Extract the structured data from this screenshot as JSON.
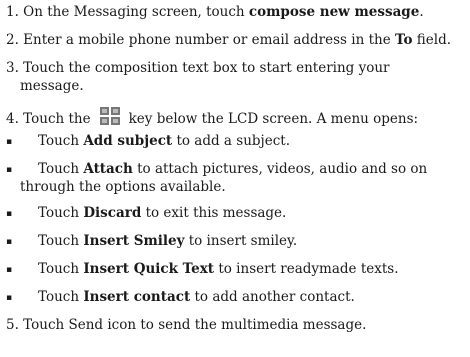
{
  "steps": {
    "s1": {
      "pre": "1. On the Messaging screen, touch ",
      "bold": "compose new message",
      "post": "."
    },
    "s2": {
      "pre": "2. Enter a mobile phone number or email address in the ",
      "bold": "To",
      "post": " field."
    },
    "s3": {
      "line1": "3. Touch the composition text box to start entering your",
      "line2": "message."
    },
    "s4": {
      "pre": "4. Touch the",
      "post": "key below the LCD screen. A menu opens:",
      "icon": "menu-key-icon"
    },
    "s5": {
      "text": "5. Touch Send icon to send the multimedia message."
    }
  },
  "menu": [
    {
      "pre": "Touch ",
      "bold": "Add subject",
      "post": " to add a subject."
    },
    {
      "pre": "Touch ",
      "bold": "Attach",
      "post": " to attach pictures, videos, audio and so on",
      "cont": "through the options available."
    },
    {
      "pre": "Touch ",
      "bold": "Discard",
      "post": " to exit this message."
    },
    {
      "pre": "Touch ",
      "bold": "Insert Smiley",
      "post": " to insert smiley."
    },
    {
      "pre": "Touch ",
      "bold": "Insert Quick Text",
      "post": " to insert readymade texts."
    },
    {
      "pre": "Touch ",
      "bold": "Insert contact",
      "post": " to add another contact."
    }
  ],
  "bullet_glyph": "▪"
}
